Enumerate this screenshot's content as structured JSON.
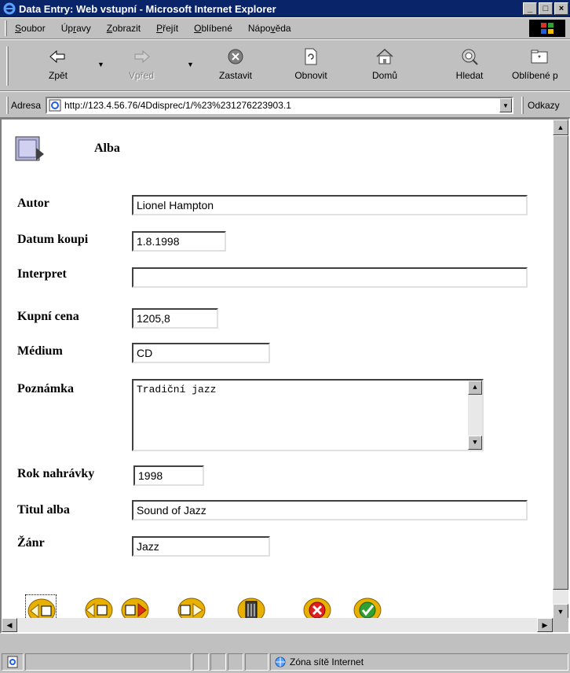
{
  "window": {
    "title": "Data Entry: Web vstupní - Microsoft Internet Explorer",
    "buttons": {
      "minimize": "_",
      "maximize": "□",
      "close": "×"
    }
  },
  "menu": [
    {
      "label": "Soubor",
      "u": "S",
      "rest": "oubor"
    },
    {
      "label": "Úpravy",
      "pre": "Úp",
      "u": "r",
      "rest": "avy"
    },
    {
      "label": "Zobrazit",
      "u": "Z",
      "rest": "obrazit"
    },
    {
      "label": "Přejít",
      "u": "P",
      "rest": "řejít"
    },
    {
      "label": "Oblíbené",
      "u": "O",
      "rest": "blíbené"
    },
    {
      "label": "Nápověda",
      "pre": "Nápo",
      "u": "v",
      "rest": "ěda"
    }
  ],
  "toolbar": {
    "back": "Zpět",
    "forward": "Vpřed",
    "stop": "Zastavit",
    "refresh": "Obnovit",
    "home": "Domů",
    "search": "Hledat",
    "favorites": "Oblíbené p"
  },
  "address": {
    "label": "Adresa",
    "url": "http://123.4.56.76/4Ddisprec/1/%23%231276223903.1",
    "links_label": "Odkazy"
  },
  "form": {
    "title": "Alba",
    "fields": {
      "autor": {
        "label": "Autor",
        "value": "Lionel Hampton"
      },
      "datum_koupi": {
        "label": "Datum koupi",
        "value": "1.8.1998"
      },
      "interpret": {
        "label": "Interpret",
        "value": ""
      },
      "kupni_cena": {
        "label": "Kupní cena",
        "value": "1205,8"
      },
      "medium": {
        "label": "Médium",
        "value": "CD"
      },
      "poznamka": {
        "label": "Poznámka",
        "value": "Tradiční jazz"
      },
      "rok_nahravky": {
        "label": "Rok nahrávky",
        "value": "1998"
      },
      "titul_alba": {
        "label": "Titul alba",
        "value": "Sound of Jazz"
      },
      "zanr": {
        "label": "Žánr",
        "value": "Jazz"
      }
    }
  },
  "status": {
    "zone": "Zóna sítě Internet"
  },
  "colors": {
    "titlebar": "#0a246a",
    "button_gold": "#e8b000",
    "cancel_red": "#e02020",
    "ok_green": "#30a030"
  }
}
